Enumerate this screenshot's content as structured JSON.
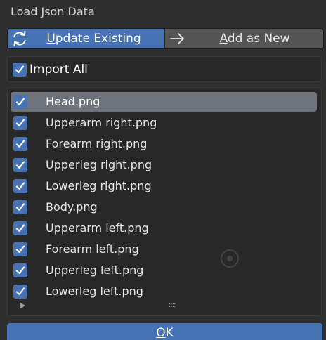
{
  "dialog": {
    "title": "Load Json Data"
  },
  "mode": {
    "options": [
      {
        "label_first": "U",
        "label_rest": "pdate Existing",
        "icon": "refresh-icon",
        "active": true
      },
      {
        "label_first": "A",
        "label_rest": "dd as New",
        "icon": "arrow-right-icon",
        "active": false
      }
    ]
  },
  "import_all": {
    "label": "Import All",
    "checked": true
  },
  "items": [
    {
      "label": "Head.png",
      "checked": true,
      "selected": true
    },
    {
      "label": "Upperarm right.png",
      "checked": true,
      "selected": false
    },
    {
      "label": "Forearm right.png",
      "checked": true,
      "selected": false
    },
    {
      "label": "Upperleg right.png",
      "checked": true,
      "selected": false
    },
    {
      "label": "Lowerleg right.png",
      "checked": true,
      "selected": false
    },
    {
      "label": "Body.png",
      "checked": true,
      "selected": false
    },
    {
      "label": "Upperarm left.png",
      "checked": true,
      "selected": false
    },
    {
      "label": "Forearm left.png",
      "checked": true,
      "selected": false
    },
    {
      "label": "Upperleg left.png",
      "checked": true,
      "selected": false
    },
    {
      "label": "Lowerleg left.png",
      "checked": true,
      "selected": false
    }
  ],
  "list_footer": {
    "expand_icon": "triangle-right-icon",
    "grip_text": "::::"
  },
  "ok_button": {
    "label_first": "O",
    "label_rest": "K"
  },
  "colors": {
    "accent": "#4772b3",
    "background": "#2e2e2e",
    "panel": "#282828",
    "selected_row": "#6e727a",
    "inactive_button": "#545454"
  }
}
